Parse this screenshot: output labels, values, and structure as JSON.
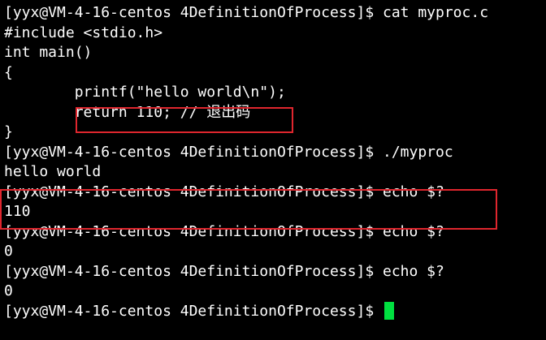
{
  "terminal": {
    "lines": [
      "[yyx@VM-4-16-centos 4DefinitionOfProcess]$ cat myproc.c",
      "#include <stdio.h>",
      "int main()",
      "{",
      "        printf(\"hello world\\n\");",
      "        return 110; // 退出码",
      "}",
      "[yyx@VM-4-16-centos 4DefinitionOfProcess]$ ./myproc",
      "hello world",
      "[yyx@VM-4-16-centos 4DefinitionOfProcess]$ echo $?",
      "110",
      "[yyx@VM-4-16-centos 4DefinitionOfProcess]$ echo $?",
      "0",
      "[yyx@VM-4-16-centos 4DefinitionOfProcess]$ echo $?",
      "0",
      "[yyx@VM-4-16-centos 4DefinitionOfProcess]$ "
    ],
    "colors": {
      "background": "#000000",
      "text": "#ffffff",
      "highlight_box": "#e0262e",
      "cursor": "#00e040"
    }
  }
}
